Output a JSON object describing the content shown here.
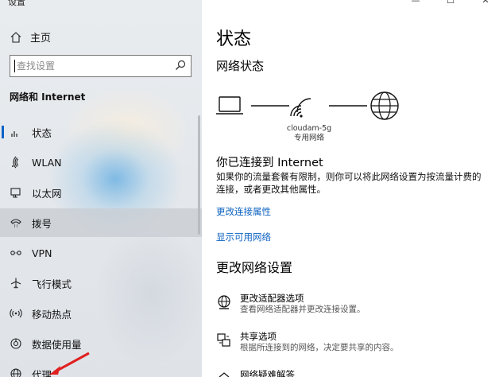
{
  "window": {
    "title": "设置",
    "controls": [
      "—",
      "☐",
      "✕"
    ]
  },
  "sidebar": {
    "home_label": "主页",
    "search_placeholder": "查找设置",
    "section_title": "网络和 Internet",
    "items": [
      {
        "label": "状态",
        "icon": "status-icon"
      },
      {
        "label": "WLAN",
        "icon": "wifi-icon"
      },
      {
        "label": "以太网",
        "icon": "ethernet-icon"
      },
      {
        "label": "拨号",
        "icon": "dialup-icon"
      },
      {
        "label": "VPN",
        "icon": "vpn-icon"
      },
      {
        "label": "飞行模式",
        "icon": "airplane-icon"
      },
      {
        "label": "移动热点",
        "icon": "hotspot-icon"
      },
      {
        "label": "数据使用量",
        "icon": "data-usage-icon"
      },
      {
        "label": "代理",
        "icon": "globe-icon"
      }
    ]
  },
  "main": {
    "title": "状态",
    "network_status_heading": "网络状态",
    "network_name": "cloudam-5g",
    "network_type": "专用网络",
    "connected_title": "你已连接到 Internet",
    "connected_desc": "如果你的流量套餐有限制，则你可以将此网络设置为按流量计费的连接，或者更改其他属性。",
    "links": {
      "change_properties": "更改连接属性",
      "show_networks": "显示可用网络"
    },
    "change_settings_heading": "更改网络设置",
    "options": [
      {
        "title": "更改适配器选项",
        "desc": "查看网络适配器并更改连接设置。",
        "icon": "adapter-globe-icon"
      },
      {
        "title": "共享选项",
        "desc": "根据所连接到的网络，决定要共享的内容。",
        "icon": "sharing-icon"
      },
      {
        "title": "网络疑难解答",
        "desc": "",
        "icon": "troubleshoot-icon"
      }
    ]
  },
  "colors": {
    "accent": "#0b63c7",
    "link": "#0b62c1",
    "arrow": "#e02020"
  }
}
